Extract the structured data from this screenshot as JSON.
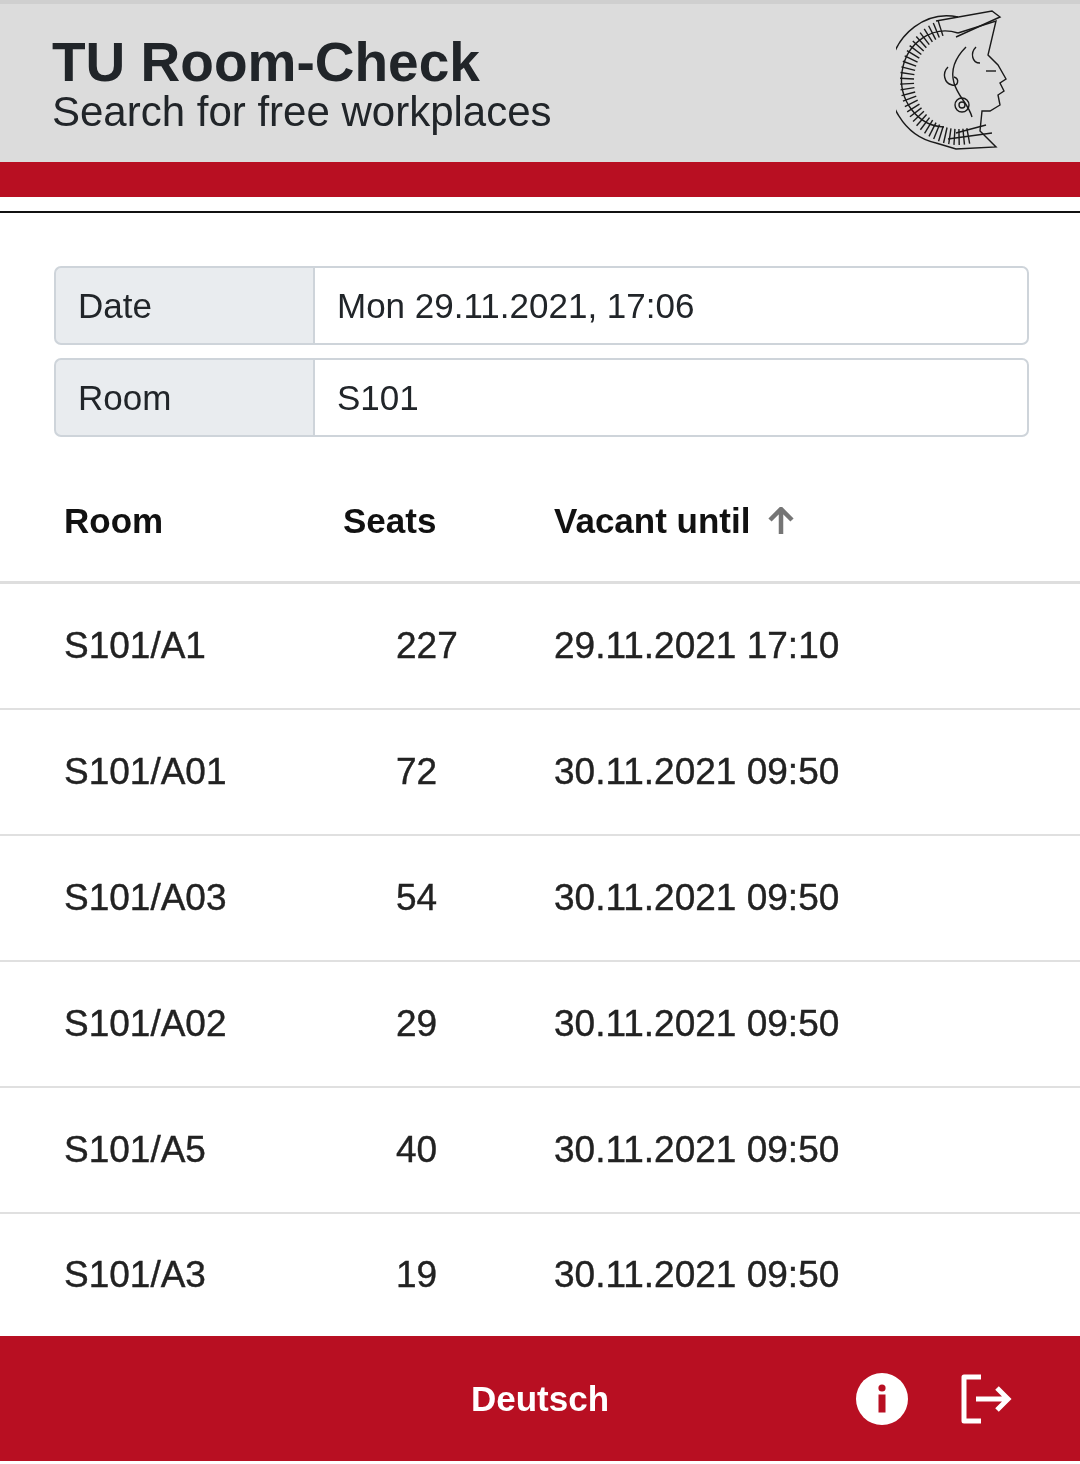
{
  "header": {
    "title": "TU Room-Check",
    "subtitle": "Search for free workplaces"
  },
  "filters": [
    {
      "label": "Date",
      "value": "Mon 29.11.2021, 17:06"
    },
    {
      "label": "Room",
      "value": "S101"
    }
  ],
  "table": {
    "columns": [
      {
        "label": "Room",
        "sorted": false
      },
      {
        "label": "Seats",
        "sorted": false
      },
      {
        "label": "Vacant until",
        "sorted": true
      }
    ],
    "rows": [
      [
        "S101/A1",
        "227",
        "29.11.2021 17:10"
      ],
      [
        "S101/A01",
        "72",
        "30.11.2021 09:50"
      ],
      [
        "S101/A03",
        "54",
        "30.11.2021 09:50"
      ],
      [
        "S101/A02",
        "29",
        "30.11.2021 09:50"
      ],
      [
        "S101/A5",
        "40",
        "30.11.2021 09:50"
      ],
      [
        "S101/A3",
        "19",
        "30.11.2021 09:50"
      ]
    ]
  },
  "footer": {
    "language": "Deutsch"
  }
}
